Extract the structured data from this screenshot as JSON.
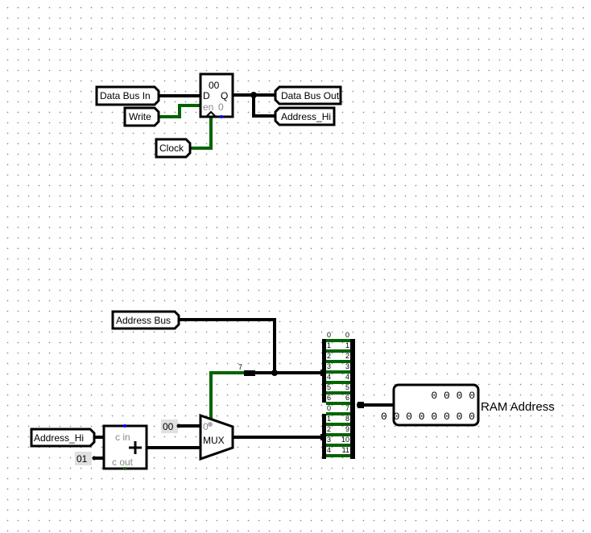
{
  "register": {
    "value": "00",
    "d_label": "D",
    "q_label": "Q",
    "en_label": "en",
    "reset_label": "0"
  },
  "pins": {
    "data_bus_in": "Data Bus In",
    "write": "Write",
    "clock": "Clock",
    "data_bus_out": "Data Bus Out",
    "address_hi_out": "Address_Hi",
    "address_bus": "Address Bus",
    "address_hi_in": "Address_Hi"
  },
  "adder": {
    "cin_label": "c in",
    "cout_label": "c out",
    "symbol": "+"
  },
  "constants": {
    "mux_const": "00",
    "adder_const": "01"
  },
  "mux": {
    "label": "MUX",
    "select_label": "0"
  },
  "bus_width_label": "7",
  "splitter_top": {
    "left": [
      "0",
      "1",
      "2",
      "3",
      "4",
      "5",
      "6"
    ],
    "right": [
      "0",
      "1",
      "2",
      "3",
      "4",
      "5",
      "6"
    ]
  },
  "splitter_bottom": {
    "left": [
      "0",
      "1",
      "2",
      "3",
      "4"
    ],
    "right": [
      "7",
      "8",
      "9",
      "10",
      "11"
    ]
  },
  "ram_probe": {
    "row1": "0 0 0 0",
    "row2": "0 0 0 0 0 0 0 0",
    "label": "RAM Address"
  },
  "colors": {
    "wire_active": "#006400",
    "wire_bus": "#000000",
    "pin_dot": "#0000ff",
    "constant_bg": "#e0e0e0"
  }
}
